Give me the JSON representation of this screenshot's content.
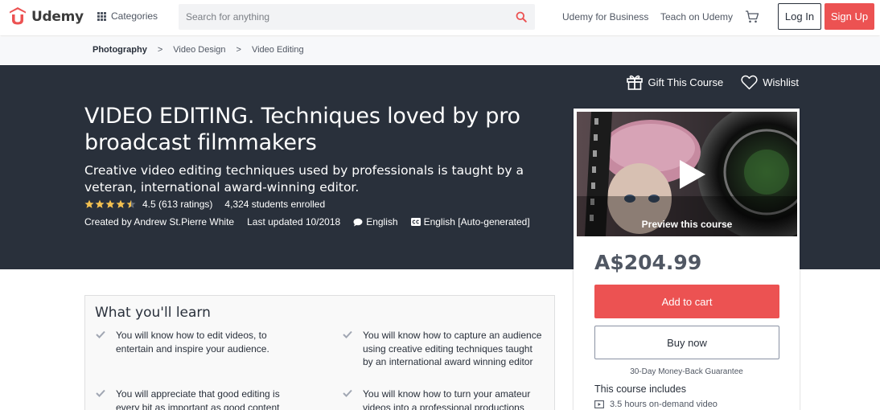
{
  "header": {
    "logo_text": "Udemy",
    "categories_label": "Categories",
    "search_placeholder": "Search for anything",
    "business_link": "Udemy for Business",
    "teach_link": "Teach on Udemy",
    "login_label": "Log In",
    "signup_label": "Sign Up"
  },
  "breadcrumb": [
    "Photography",
    "Video Design",
    "Video Editing"
  ],
  "breadcrumb_separator": ">",
  "hero": {
    "gift_label": "Gift This Course",
    "wishlist_label": "Wishlist",
    "title": "VIDEO EDITING. Techniques loved by pro broadcast filmmakers",
    "subtitle": "Creative video editing techniques used by professionals is taught by a veteran, international award-winning editor.",
    "rating_value": 4.5,
    "rating_text": "4.5 (613 ratings)",
    "enrolled_text": "4,324 students enrolled",
    "created_by": "Created by Andrew St.Pierre White",
    "last_updated": "Last updated 10/2018",
    "language": "English",
    "captions": "English [Auto-generated]"
  },
  "card": {
    "preview_label": "Preview this course",
    "price": "A$204.99",
    "add_to_cart_label": "Add to cart",
    "buy_now_label": "Buy now",
    "guarantee": "30-Day Money-Back Guarantee",
    "includes_heading": "This course includes",
    "includes_items": [
      "3.5 hours on-demand video"
    ]
  },
  "learn": {
    "heading": "What you'll learn",
    "items": [
      "You will know how to edit videos, to entertain and inspire your audience.",
      "You will know how to capture an audience using creative editing techniques taught by an international award winning editor",
      "You will appreciate that good editing is every bit as important as good content",
      "You will know how to turn your amateur videos into a professional productions"
    ]
  },
  "colors": {
    "brand_red": "#ec5252",
    "hero_bg": "#29303b",
    "star": "#f4c150",
    "text_dark": "#29303b",
    "text_muted": "#505763"
  },
  "icons": {
    "logo": "udemy-logo-icon",
    "categories": "grid-icon",
    "search": "search-icon",
    "cart": "cart-icon",
    "gift": "gift-icon",
    "wishlist": "heart-icon",
    "language": "speech-bubble-icon",
    "captions": "cc-icon",
    "play": "play-icon",
    "check": "check-icon",
    "video": "video-icon"
  }
}
